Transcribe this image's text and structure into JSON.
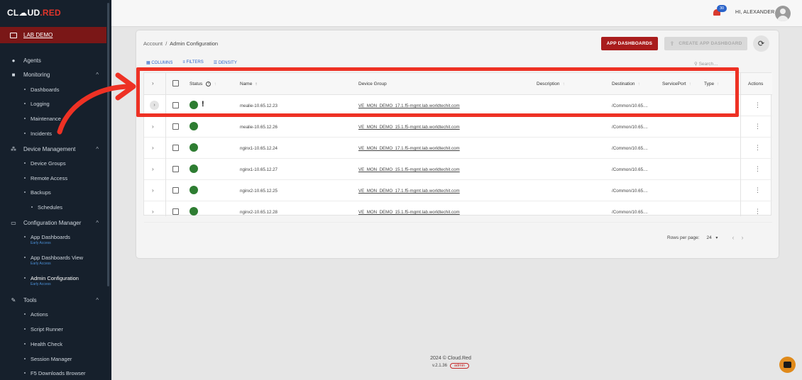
{
  "brand": {
    "logo": "CL",
    "logo_mid": "☁UD",
    "logo_red": ".RED"
  },
  "sidebar": {
    "env": "LAB DEMO",
    "items": [
      {
        "type": "top",
        "label": "Agents",
        "icon": "agents-icon"
      },
      {
        "type": "top",
        "label": "Monitoring",
        "icon": "monitoring-icon",
        "expanded": true
      },
      {
        "type": "sub",
        "label": "Dashboards"
      },
      {
        "type": "sub",
        "label": "Logging"
      },
      {
        "type": "sub",
        "label": "Maintenance"
      },
      {
        "type": "sub",
        "label": "Incidents"
      },
      {
        "type": "top",
        "label": "Device Management",
        "icon": "device-management-icon",
        "expanded": true
      },
      {
        "type": "sub",
        "label": "Device Groups"
      },
      {
        "type": "sub",
        "label": "Remote Access"
      },
      {
        "type": "sub",
        "label": "Backups"
      },
      {
        "type": "subsub",
        "label": "Schedules"
      },
      {
        "type": "top",
        "label": "Configuration Manager",
        "icon": "configuration-manager-icon",
        "expanded": true
      },
      {
        "type": "sub",
        "label": "App Dashboards",
        "tag": "Early Access"
      },
      {
        "type": "sub",
        "label": "App Dashboards View",
        "tag": "Early Access"
      },
      {
        "type": "sub",
        "label": "Admin Configuration",
        "tag": "Early Access",
        "active": true
      },
      {
        "type": "top",
        "label": "Tools",
        "icon": "tools-icon",
        "expanded": true
      },
      {
        "type": "sub",
        "label": "Actions"
      },
      {
        "type": "sub",
        "label": "Script Runner"
      },
      {
        "type": "sub",
        "label": "Health Check"
      },
      {
        "type": "sub",
        "label": "Session Manager"
      },
      {
        "type": "sub",
        "label": "F5 Downloads Browser"
      }
    ]
  },
  "topbar": {
    "notifications": "30",
    "greeting": "HI, ALEXANDER"
  },
  "breadcrumb": {
    "root": "Account",
    "sep": "/",
    "current": "Admin Configuration"
  },
  "actions": {
    "app_dashboards": "APP DASHBOARDS",
    "create_app_dashboard": "CREATE APP DASHBOARD"
  },
  "toolbar": {
    "columns": "COLUMNS",
    "filters": "FILTERS",
    "density": "DENSITY",
    "search_placeholder": "Search…"
  },
  "table": {
    "columns": {
      "status": "Status",
      "name": "Name",
      "device_group": "Device Group",
      "description": "Description",
      "destination": "Destination",
      "service_port": "ServicePort",
      "type": "Type",
      "actions": "Actions"
    },
    "rows": [
      {
        "name": "mealie-10.65.12.23",
        "group": "VE_MON_DEMO_17.1.f5-mgmt.lab.worldtechit.com",
        "destination": "/Common/10.65....",
        "warn": true
      },
      {
        "name": "mealie-10.65.12.26",
        "group": "VE_MON_DEMO_15.1.f5-mgmt.lab.worldtechit.com",
        "destination": "/Common/10.65....",
        "warn": false
      },
      {
        "name": "nginx1-10.65.12.24",
        "group": "VE_MON_DEMO_17.1.f5-mgmt.lab.worldtechit.com",
        "destination": "/Common/10.65....",
        "warn": false
      },
      {
        "name": "nginx1-10.65.12.27",
        "group": "VE_MON_DEMO_15.1.f5-mgmt.lab.worldtechit.com",
        "destination": "/Common/10.65....",
        "warn": false
      },
      {
        "name": "nginx2-10.65.12.25",
        "group": "VE_MON_DEMO_17.1.f5-mgmt.lab.worldtechit.com",
        "destination": "/Common/10.65....",
        "warn": false
      },
      {
        "name": "nginx2-10.65.12.28",
        "group": "VE_MON_DEMO_15.1.f5-mgmt.lab.worldtechit.com",
        "destination": "/Common/10.65....",
        "warn": false
      }
    ]
  },
  "pager": {
    "label": "Rows per page:",
    "value": "24"
  },
  "footer": {
    "copyright": "2024 © Cloud.Red",
    "version": "v.2.1.36",
    "role": "admin"
  },
  "colors": {
    "accent_red": "#a91c1c",
    "highlight": "#ee3124",
    "status_ok": "#2e7d32"
  }
}
